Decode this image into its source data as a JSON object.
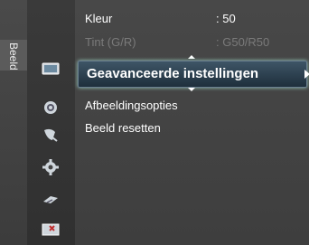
{
  "side_tab": {
    "label": "Beeld"
  },
  "sidebar": {
    "icons": [
      "picture-icon",
      "sound-icon",
      "channel-icon",
      "settings-icon",
      "input-icon",
      "application-icon"
    ]
  },
  "menu": {
    "items": [
      {
        "label": "Kleur",
        "value": ": 50",
        "enabled": true
      },
      {
        "label": "Tint (G/R)",
        "value": ": G50/R50",
        "enabled": false
      },
      {
        "label": "Geavanceerde instellingen",
        "selected": true
      },
      {
        "label": "Afbeeldingsopties"
      },
      {
        "label": "Beeld resetten"
      }
    ]
  }
}
